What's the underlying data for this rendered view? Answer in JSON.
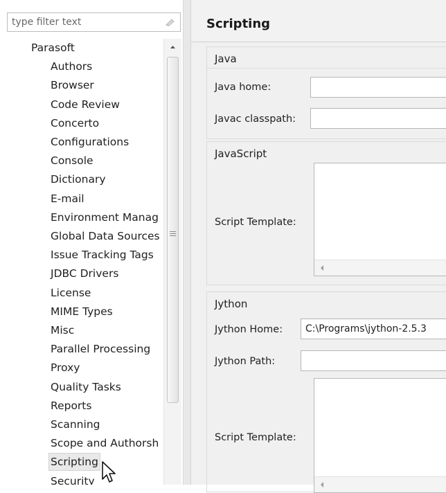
{
  "filter": {
    "placeholder": "type filter text"
  },
  "tree": {
    "root": "Parasoft",
    "items": [
      "Authors",
      "Browser",
      "Code Review",
      "Concerto",
      "Configurations",
      "Console",
      "Dictionary",
      "E-mail",
      "Environment Manag",
      "Global Data Sources",
      "Issue Tracking Tags",
      "JDBC Drivers",
      "License",
      "MIME Types",
      "Misc",
      "Parallel Processing",
      "Proxy",
      "Quality Tasks",
      "Reports",
      "Scanning",
      "Scope and Authorsh",
      "Scripting",
      "Security"
    ],
    "selected": "Scripting"
  },
  "page": {
    "title": "Scripting"
  },
  "java": {
    "group_title": "Java",
    "java_home_label": "Java home:",
    "java_home_value": "",
    "javac_classpath_label": "Javac classpath:",
    "javac_classpath_value": ""
  },
  "javascript": {
    "group_title": "JavaScript",
    "script_template_label": "Script Template:"
  },
  "jython": {
    "group_title": "Jython",
    "jython_home_label": "Jython Home:",
    "jython_home_value": "C:\\Programs\\jython-2.5.3",
    "jython_path_label": "Jython Path:",
    "jython_path_value": "",
    "script_template_label": "Script Template:"
  },
  "icons": {
    "clear": "clear-filter-icon",
    "scroll_up": "scroll-up-arrow-icon",
    "scroll_grip": "scroll-grip-icon",
    "scroll_left": "scroll-left-arrow-icon",
    "cursor": "mouse-pointer-icon"
  }
}
